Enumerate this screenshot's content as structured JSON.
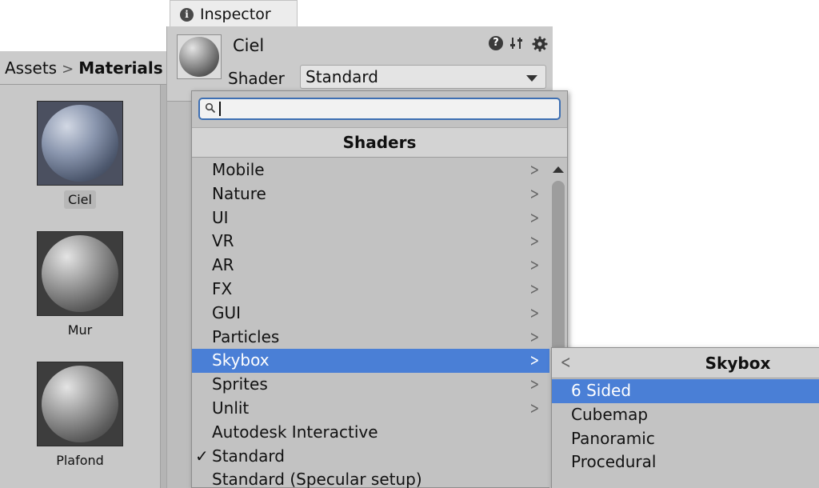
{
  "assets_panel": {
    "breadcrumb": {
      "root": "Assets",
      "separator": ">",
      "current": "Materials"
    },
    "items": [
      {
        "label": "Ciel",
        "selected": true,
        "preview": "blue-sphere"
      },
      {
        "label": "Mur",
        "selected": false,
        "preview": "grey-sphere"
      },
      {
        "label": "Plafond",
        "selected": false,
        "preview": "grey-sphere"
      }
    ]
  },
  "inspector": {
    "tab_label": "Inspector",
    "tab_icon": "info-icon",
    "material_name": "Ciel",
    "shader_label": "Shader",
    "shader_value": "Standard",
    "header_icons": [
      "help-icon",
      "preset-icon",
      "gear-icon"
    ]
  },
  "shader_popup": {
    "search_value": "",
    "title": "Shaders",
    "items": [
      {
        "label": "Mobile",
        "submenu": true
      },
      {
        "label": "Nature",
        "submenu": true
      },
      {
        "label": "UI",
        "submenu": true
      },
      {
        "label": "VR",
        "submenu": true
      },
      {
        "label": "AR",
        "submenu": true
      },
      {
        "label": "FX",
        "submenu": true
      },
      {
        "label": "GUI",
        "submenu": true
      },
      {
        "label": "Particles",
        "submenu": true
      },
      {
        "label": "Skybox",
        "submenu": true,
        "highlighted": true
      },
      {
        "label": "Sprites",
        "submenu": true
      },
      {
        "label": "Unlit",
        "submenu": true
      },
      {
        "label": "Autodesk Interactive",
        "submenu": false
      },
      {
        "label": "Standard",
        "submenu": false,
        "checked": true
      },
      {
        "label": "Standard (Specular setup)",
        "submenu": false
      }
    ],
    "check_mark": "✓",
    "chevron": ">"
  },
  "skybox_submenu": {
    "back": "<",
    "title": "Skybox",
    "items": [
      {
        "label": "6 Sided",
        "highlighted": true
      },
      {
        "label": "Cubemap"
      },
      {
        "label": "Panoramic"
      },
      {
        "label": "Procedural"
      }
    ]
  },
  "colors": {
    "highlight": "#4a7fd6",
    "search_focus": "#3d6fb3",
    "panel_bg": "#c5c5c5"
  }
}
